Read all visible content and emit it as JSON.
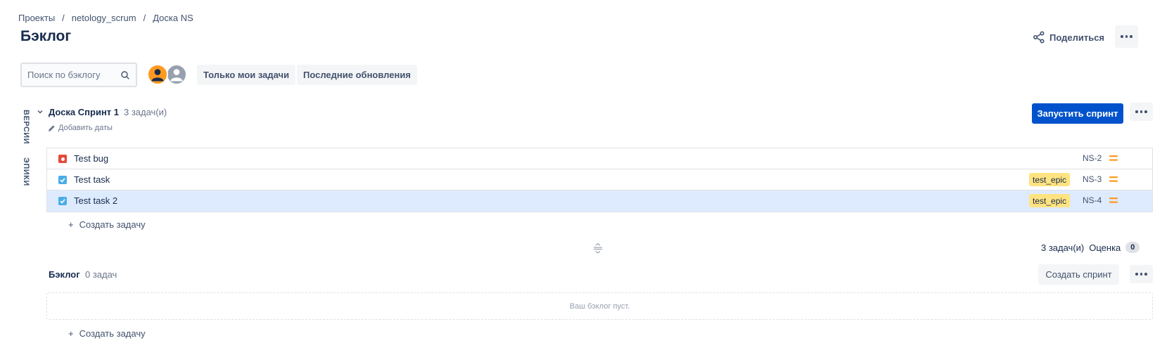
{
  "breadcrumb": {
    "items": [
      "Проекты",
      "netology_scrum",
      "Доска NS"
    ],
    "separator": "/"
  },
  "page": {
    "title": "Бэклог"
  },
  "header_actions": {
    "share_label": "Поделиться"
  },
  "toolbar": {
    "search_placeholder": "Поиск по бэклогу",
    "filter_mine": "Только мои задачи",
    "filter_recent": "Последние обновления"
  },
  "side_tabs": {
    "versions": "ВЕРСИИ",
    "epics": "ЭПИКИ"
  },
  "sprint": {
    "name": "Доска Спринт 1",
    "count": "3 задач(и)",
    "add_dates": "Добавить даты",
    "start_button": "Запустить спринт",
    "issues": [
      {
        "type": "bug",
        "summary": "Test bug",
        "epic": "",
        "key": "NS-2",
        "priority": "medium",
        "selected": false
      },
      {
        "type": "task",
        "summary": "Test task",
        "epic": "test_epic",
        "key": "NS-3",
        "priority": "medium",
        "selected": false
      },
      {
        "type": "task",
        "summary": "Test task 2",
        "epic": "test_epic",
        "key": "NS-4",
        "priority": "medium",
        "selected": true
      }
    ],
    "create_task": "Создать задачу",
    "summary_count": "3 задач(и)",
    "estimate_label": "Оценка",
    "estimate_value": "0"
  },
  "backlog": {
    "name": "Бэклог",
    "count": "0 задач",
    "create_sprint": "Создать спринт",
    "empty_text": "Ваш бэклог пуст.",
    "create_task": "Создать задачу"
  },
  "colors": {
    "primary": "#0052cc",
    "bug": "#e5493a",
    "task": "#4bade8",
    "epic": "#ffe380",
    "priority_medium": "#ff991f",
    "selected_row": "#deebff"
  }
}
